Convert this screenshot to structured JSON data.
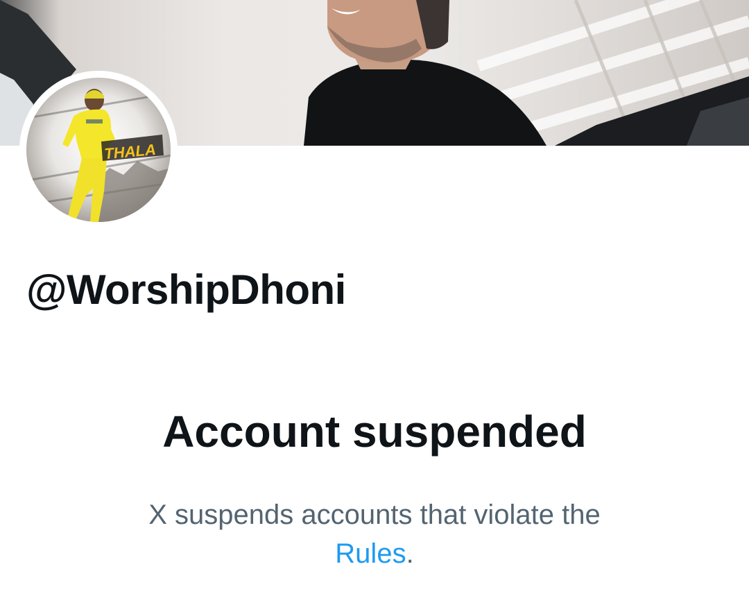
{
  "profile": {
    "handle": "@WorshipDhoni",
    "avatar_overlay_text": "THALA"
  },
  "suspension": {
    "title": "Account suspended",
    "message": "X suspends accounts that violate the",
    "rules_link": "Rules",
    "period": "."
  },
  "colors": {
    "text_primary": "#0f1419",
    "text_secondary": "#536471",
    "link": "#1d9bf0",
    "jersey_yellow": "#f4e62a"
  }
}
